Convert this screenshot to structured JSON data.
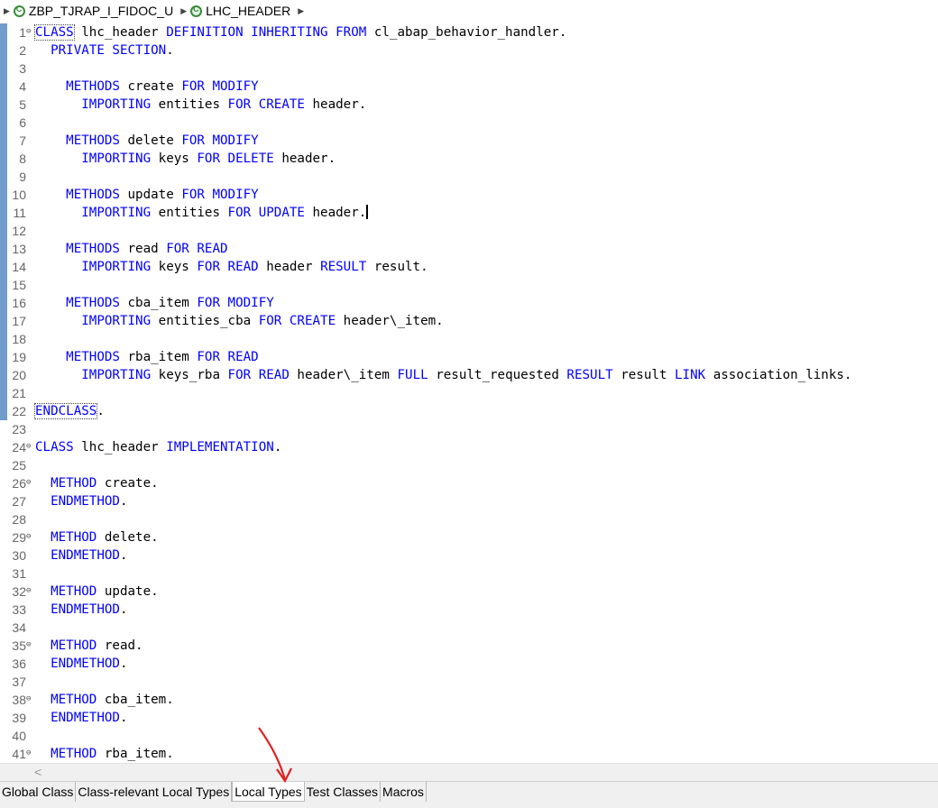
{
  "breadcrumb": {
    "items": [
      {
        "label": "ZBP_TJRAP_I_FIDOC_U",
        "icon": "class-icon"
      },
      {
        "label": "LHC_HEADER",
        "icon": "local-class-icon"
      }
    ]
  },
  "editor": {
    "lines": [
      {
        "n": "1",
        "fold": true,
        "tokens": [
          [
            "kw-box",
            "CLASS"
          ],
          [
            "t",
            " lhc_header "
          ],
          [
            "kw",
            "DEFINITION INHERITING FROM"
          ],
          [
            "t",
            " cl_abap_behavior_handler."
          ]
        ]
      },
      {
        "n": "2",
        "tokens": [
          [
            "t",
            "  "
          ],
          [
            "kw",
            "PRIVATE SECTION"
          ],
          [
            "t",
            "."
          ]
        ]
      },
      {
        "n": "3",
        "tokens": []
      },
      {
        "n": "4",
        "tokens": [
          [
            "t",
            "    "
          ],
          [
            "kw",
            "METHODS"
          ],
          [
            "t",
            " create "
          ],
          [
            "kw",
            "FOR MODIFY"
          ]
        ]
      },
      {
        "n": "5",
        "tokens": [
          [
            "t",
            "      "
          ],
          [
            "kw",
            "IMPORTING"
          ],
          [
            "t",
            " entities "
          ],
          [
            "kw",
            "FOR CREATE"
          ],
          [
            "t",
            " header."
          ]
        ]
      },
      {
        "n": "6",
        "tokens": []
      },
      {
        "n": "7",
        "tokens": [
          [
            "t",
            "    "
          ],
          [
            "kw",
            "METHODS"
          ],
          [
            "t",
            " delete "
          ],
          [
            "kw",
            "FOR MODIFY"
          ]
        ]
      },
      {
        "n": "8",
        "tokens": [
          [
            "t",
            "      "
          ],
          [
            "kw",
            "IMPORTING"
          ],
          [
            "t",
            " keys "
          ],
          [
            "kw",
            "FOR DELETE"
          ],
          [
            "t",
            " header."
          ]
        ]
      },
      {
        "n": "9",
        "tokens": []
      },
      {
        "n": "10",
        "tokens": [
          [
            "t",
            "    "
          ],
          [
            "kw",
            "METHODS"
          ],
          [
            "t",
            " update "
          ],
          [
            "kw",
            "FOR MODIFY"
          ]
        ]
      },
      {
        "n": "11",
        "tokens": [
          [
            "t",
            "      "
          ],
          [
            "kw",
            "IMPORTING"
          ],
          [
            "t",
            " entities "
          ],
          [
            "kw",
            "FOR UPDATE"
          ],
          [
            "t",
            " header."
          ],
          [
            "caret",
            ""
          ]
        ]
      },
      {
        "n": "12",
        "tokens": []
      },
      {
        "n": "13",
        "tokens": [
          [
            "t",
            "    "
          ],
          [
            "kw",
            "METHODS"
          ],
          [
            "t",
            " read "
          ],
          [
            "kw",
            "FOR READ"
          ]
        ]
      },
      {
        "n": "14",
        "tokens": [
          [
            "t",
            "      "
          ],
          [
            "kw",
            "IMPORTING"
          ],
          [
            "t",
            " keys "
          ],
          [
            "kw",
            "FOR READ"
          ],
          [
            "t",
            " header "
          ],
          [
            "kw",
            "RESULT"
          ],
          [
            "t",
            " result."
          ]
        ]
      },
      {
        "n": "15",
        "tokens": []
      },
      {
        "n": "16",
        "tokens": [
          [
            "t",
            "    "
          ],
          [
            "kw",
            "METHODS"
          ],
          [
            "t",
            " cba_item "
          ],
          [
            "kw",
            "FOR MODIFY"
          ]
        ]
      },
      {
        "n": "17",
        "tokens": [
          [
            "t",
            "      "
          ],
          [
            "kw",
            "IMPORTING"
          ],
          [
            "t",
            " entities_cba "
          ],
          [
            "kw",
            "FOR CREATE"
          ],
          [
            "t",
            " header\\_item."
          ]
        ]
      },
      {
        "n": "18",
        "tokens": []
      },
      {
        "n": "19",
        "tokens": [
          [
            "t",
            "    "
          ],
          [
            "kw",
            "METHODS"
          ],
          [
            "t",
            " rba_item "
          ],
          [
            "kw",
            "FOR READ"
          ]
        ]
      },
      {
        "n": "20",
        "tokens": [
          [
            "t",
            "      "
          ],
          [
            "kw",
            "IMPORTING"
          ],
          [
            "t",
            " keys_rba "
          ],
          [
            "kw",
            "FOR READ"
          ],
          [
            "t",
            " header\\_item "
          ],
          [
            "kw",
            "FULL"
          ],
          [
            "t",
            " result_requested "
          ],
          [
            "kw",
            "RESULT"
          ],
          [
            "t",
            " result "
          ],
          [
            "kw",
            "LINK"
          ],
          [
            "t",
            " association_links."
          ]
        ]
      },
      {
        "n": "21",
        "tokens": []
      },
      {
        "n": "22",
        "tokens": [
          [
            "kw-box",
            "ENDCLASS"
          ],
          [
            "t",
            "."
          ]
        ]
      },
      {
        "n": "23",
        "tokens": []
      },
      {
        "n": "24",
        "fold": true,
        "tokens": [
          [
            "kw",
            "CLASS"
          ],
          [
            "t",
            " lhc_header "
          ],
          [
            "kw",
            "IMPLEMENTATION"
          ],
          [
            "t",
            "."
          ]
        ]
      },
      {
        "n": "25",
        "tokens": []
      },
      {
        "n": "26",
        "fold": true,
        "tokens": [
          [
            "t",
            "  "
          ],
          [
            "kw",
            "METHOD"
          ],
          [
            "t",
            " create."
          ]
        ]
      },
      {
        "n": "27",
        "tokens": [
          [
            "t",
            "  "
          ],
          [
            "kw",
            "ENDMETHOD"
          ],
          [
            "t",
            "."
          ]
        ]
      },
      {
        "n": "28",
        "tokens": []
      },
      {
        "n": "29",
        "fold": true,
        "tokens": [
          [
            "t",
            "  "
          ],
          [
            "kw",
            "METHOD"
          ],
          [
            "t",
            " delete."
          ]
        ]
      },
      {
        "n": "30",
        "tokens": [
          [
            "t",
            "  "
          ],
          [
            "kw",
            "ENDMETHOD"
          ],
          [
            "t",
            "."
          ]
        ]
      },
      {
        "n": "31",
        "tokens": []
      },
      {
        "n": "32",
        "fold": true,
        "tokens": [
          [
            "t",
            "  "
          ],
          [
            "kw",
            "METHOD"
          ],
          [
            "t",
            " update."
          ]
        ]
      },
      {
        "n": "33",
        "tokens": [
          [
            "t",
            "  "
          ],
          [
            "kw",
            "ENDMETHOD"
          ],
          [
            "t",
            "."
          ]
        ]
      },
      {
        "n": "34",
        "tokens": []
      },
      {
        "n": "35",
        "fold": true,
        "tokens": [
          [
            "t",
            "  "
          ],
          [
            "kw",
            "METHOD"
          ],
          [
            "t",
            " read."
          ]
        ]
      },
      {
        "n": "36",
        "tokens": [
          [
            "t",
            "  "
          ],
          [
            "kw",
            "ENDMETHOD"
          ],
          [
            "t",
            "."
          ]
        ]
      },
      {
        "n": "37",
        "tokens": []
      },
      {
        "n": "38",
        "fold": true,
        "tokens": [
          [
            "t",
            "  "
          ],
          [
            "kw",
            "METHOD"
          ],
          [
            "t",
            " cba_item."
          ]
        ]
      },
      {
        "n": "39",
        "tokens": [
          [
            "t",
            "  "
          ],
          [
            "kw",
            "ENDMETHOD"
          ],
          [
            "t",
            "."
          ]
        ]
      },
      {
        "n": "40",
        "tokens": []
      },
      {
        "n": "41",
        "fold": true,
        "tokens": [
          [
            "t",
            "  "
          ],
          [
            "kw",
            "METHOD"
          ],
          [
            "t",
            " rba_item."
          ]
        ]
      }
    ]
  },
  "scrollbar": {
    "left_arrow": "<"
  },
  "tabs": [
    {
      "label": "Global Class",
      "active": false
    },
    {
      "label": "Class-relevant Local Types",
      "active": false
    },
    {
      "label": "Local Types",
      "active": true
    },
    {
      "label": "Test Classes",
      "active": false
    },
    {
      "label": "Macros",
      "active": false
    }
  ],
  "colors": {
    "keyword": "#0000ff",
    "annotation": "#e02020",
    "change_bar": "#6f9ccb"
  }
}
